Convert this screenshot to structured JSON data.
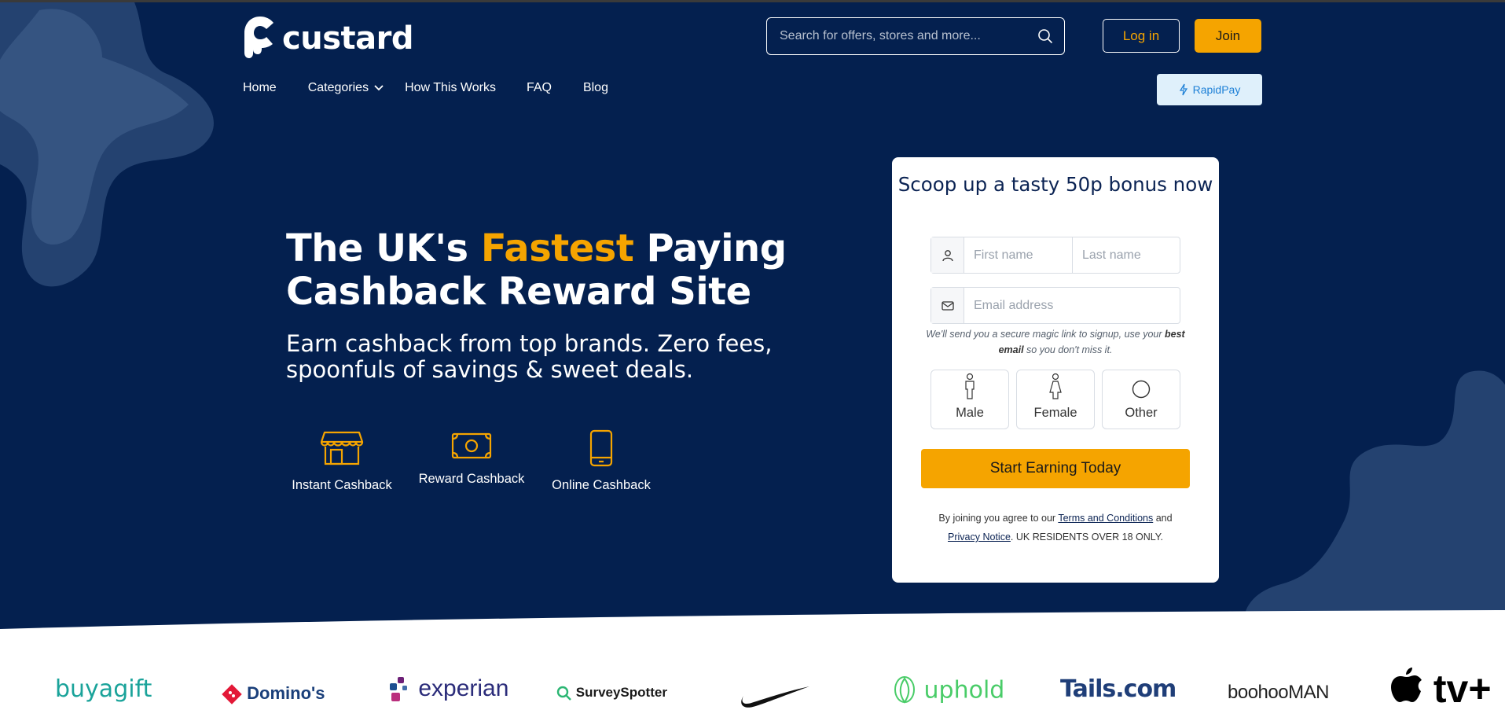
{
  "header": {
    "logo_text": "custard",
    "search_placeholder": "Search for offers, stores and more...",
    "login_label": "Log in",
    "join_label": "Join",
    "rapidpay_label": "RapidPay"
  },
  "nav": {
    "items": [
      {
        "label": "Home"
      },
      {
        "label": "Categories"
      },
      {
        "label": "How This Works"
      },
      {
        "label": "FAQ"
      },
      {
        "label": "Blog"
      }
    ]
  },
  "hero": {
    "headline_part1": "The UK's ",
    "headline_accent": "Fastest",
    "headline_part2": " Paying Cashback Reward Site",
    "subtitle": "Earn cashback from top brands. Zero fees, spoonfuls of savings & sweet deals.",
    "features": [
      {
        "label": "Instant Cashback",
        "icon": "store-icon"
      },
      {
        "label": "Reward Cashback",
        "icon": "banknote-icon"
      },
      {
        "label": "Online Cashback",
        "icon": "phone-icon"
      }
    ]
  },
  "signup": {
    "title": "Scoop up a tasty 50p bonus now",
    "first_name_placeholder": "First name",
    "last_name_placeholder": "Last name",
    "email_placeholder": "Email address",
    "note_part1": "We'll send you a secure magic link to signup, use your ",
    "note_bold": "best email",
    "note_part2": " so you don't miss it.",
    "genders": [
      {
        "label": "Male"
      },
      {
        "label": "Female"
      },
      {
        "label": "Other"
      }
    ],
    "cta_label": "Start Earning Today",
    "legal_part1": "By joining you agree to our ",
    "terms_label": "Terms and Conditions",
    "legal_part2": " and ",
    "privacy_label": "Privacy Notice",
    "legal_part3": ". UK RESIDENTS OVER 18 ONLY."
  },
  "brands": [
    "buyagift",
    "Domino's",
    "experian",
    "SurveySpotter",
    "",
    "uphold",
    "Tails.com",
    "boohooMAN",
    "tv+"
  ],
  "colors": {
    "navy": "#04204f",
    "accent": "#f5a400",
    "rapidpay_bg": "#dff0fb"
  }
}
